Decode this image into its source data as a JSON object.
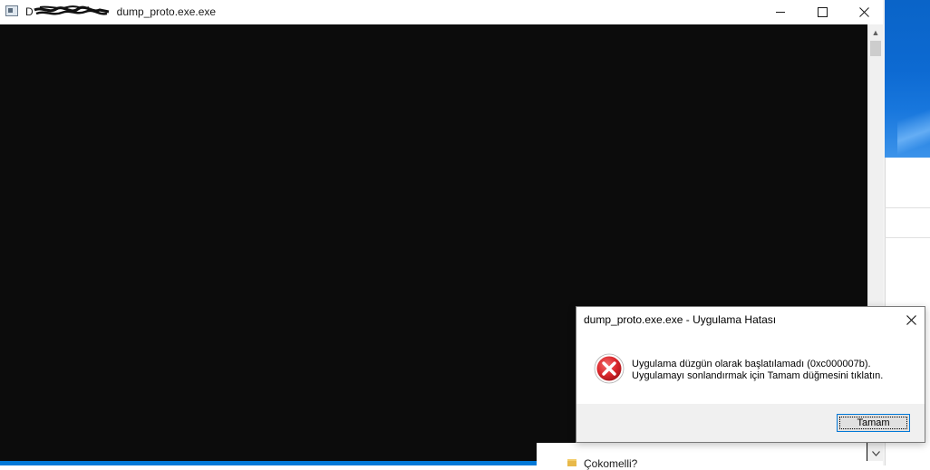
{
  "console_window": {
    "title": "D:\\...\\dump_proto.exe.exe",
    "title_visible_suffix": "dump_proto.exe.exe",
    "controls": {
      "minimize": "minimize",
      "maximize": "maximize",
      "close": "close"
    }
  },
  "error_dialog": {
    "title": "dump_proto.exe.exe - Uygulama Hatası",
    "message_line1": "Uygulama düzgün olarak başlatılamadı (0xc000007b).",
    "message_line2": "Uygulamayı sonlandırmak için Tamam düğmesini tıklatın.",
    "ok_label": "Tamam",
    "icon": "error-icon"
  },
  "background_window": {
    "partial_text": "Çokomelli?"
  },
  "colors": {
    "console_bg": "#0c0c0c",
    "accent": "#0078d7",
    "error_red": "#d9262b"
  }
}
